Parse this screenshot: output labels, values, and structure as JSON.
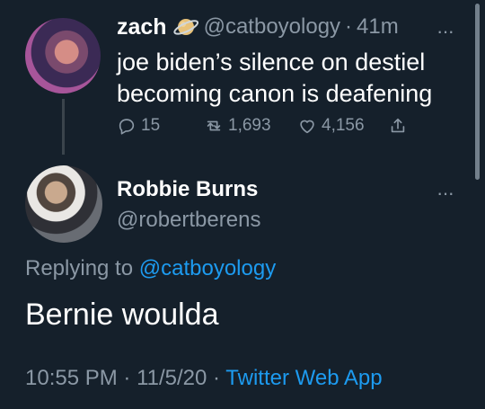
{
  "colors": {
    "background": "#15202b",
    "text": "#ffffff",
    "muted": "#8b98a5",
    "accent": "#1d9bf0",
    "thread_line": "#3a444c"
  },
  "tweet1": {
    "name": "zach",
    "badge_icon": "planet-icon",
    "handle": "@catboyology",
    "separator": "·",
    "time": "41m",
    "more": "···",
    "text_lines": [
      "joe biden’s silence on destiel",
      "becoming canon is deafening"
    ],
    "actions": {
      "reply_count": "15",
      "retweet_count": "1,693",
      "like_count": "4,156"
    }
  },
  "tweet2": {
    "name": "Robbie Burns",
    "handle": "@robertberens",
    "more": "···",
    "replying_label": "Replying to",
    "replying_handle": "@catboyology",
    "text": "Bernie woulda",
    "time": "10:55 PM",
    "separator": "·",
    "date": "11/5/20",
    "source": "Twitter Web App"
  }
}
